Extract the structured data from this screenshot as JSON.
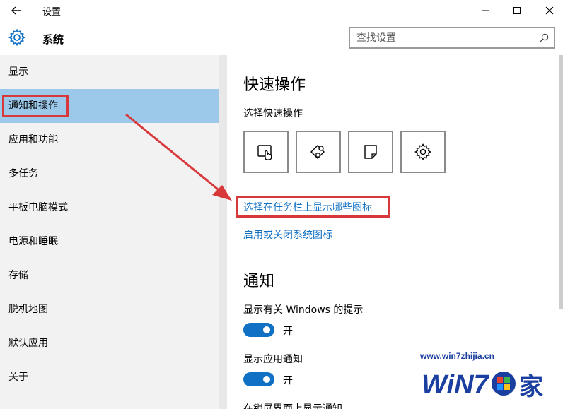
{
  "window": {
    "title": "设置"
  },
  "header": {
    "section_title": "系统",
    "search_placeholder": "查找设置"
  },
  "sidebar": {
    "items": [
      {
        "label": "显示"
      },
      {
        "label": "通知和操作"
      },
      {
        "label": "应用和功能"
      },
      {
        "label": "多任务"
      },
      {
        "label": "平板电脑模式"
      },
      {
        "label": "电源和睡眠"
      },
      {
        "label": "存储"
      },
      {
        "label": "脱机地图"
      },
      {
        "label": "默认应用"
      },
      {
        "label": "关于"
      }
    ],
    "selected_index": 1
  },
  "main": {
    "quick_actions": {
      "heading": "快速操作",
      "subheading": "选择快速操作",
      "tiles": [
        {
          "icon": "tablet-mode-icon"
        },
        {
          "icon": "location-icon"
        },
        {
          "icon": "note-icon"
        },
        {
          "icon": "settings-gear-icon"
        }
      ]
    },
    "links": {
      "taskbar_icons": "选择在任务栏上显示哪些图标",
      "system_icons": "启用或关闭系统图标"
    },
    "notifications": {
      "heading": "通知",
      "settings": [
        {
          "label": "显示有关 Windows 的提示",
          "state": "开"
        },
        {
          "label": "显示应用通知",
          "state": "开"
        },
        {
          "label": "在锁屏界面上显示通知"
        }
      ]
    }
  },
  "watermark": {
    "url": "www.win7zhijia.cn",
    "logo_text": "WiN7.家"
  },
  "colors": {
    "accent": "#1070c4",
    "selected": "#9cc8ea",
    "annotation": "#d9383b"
  }
}
